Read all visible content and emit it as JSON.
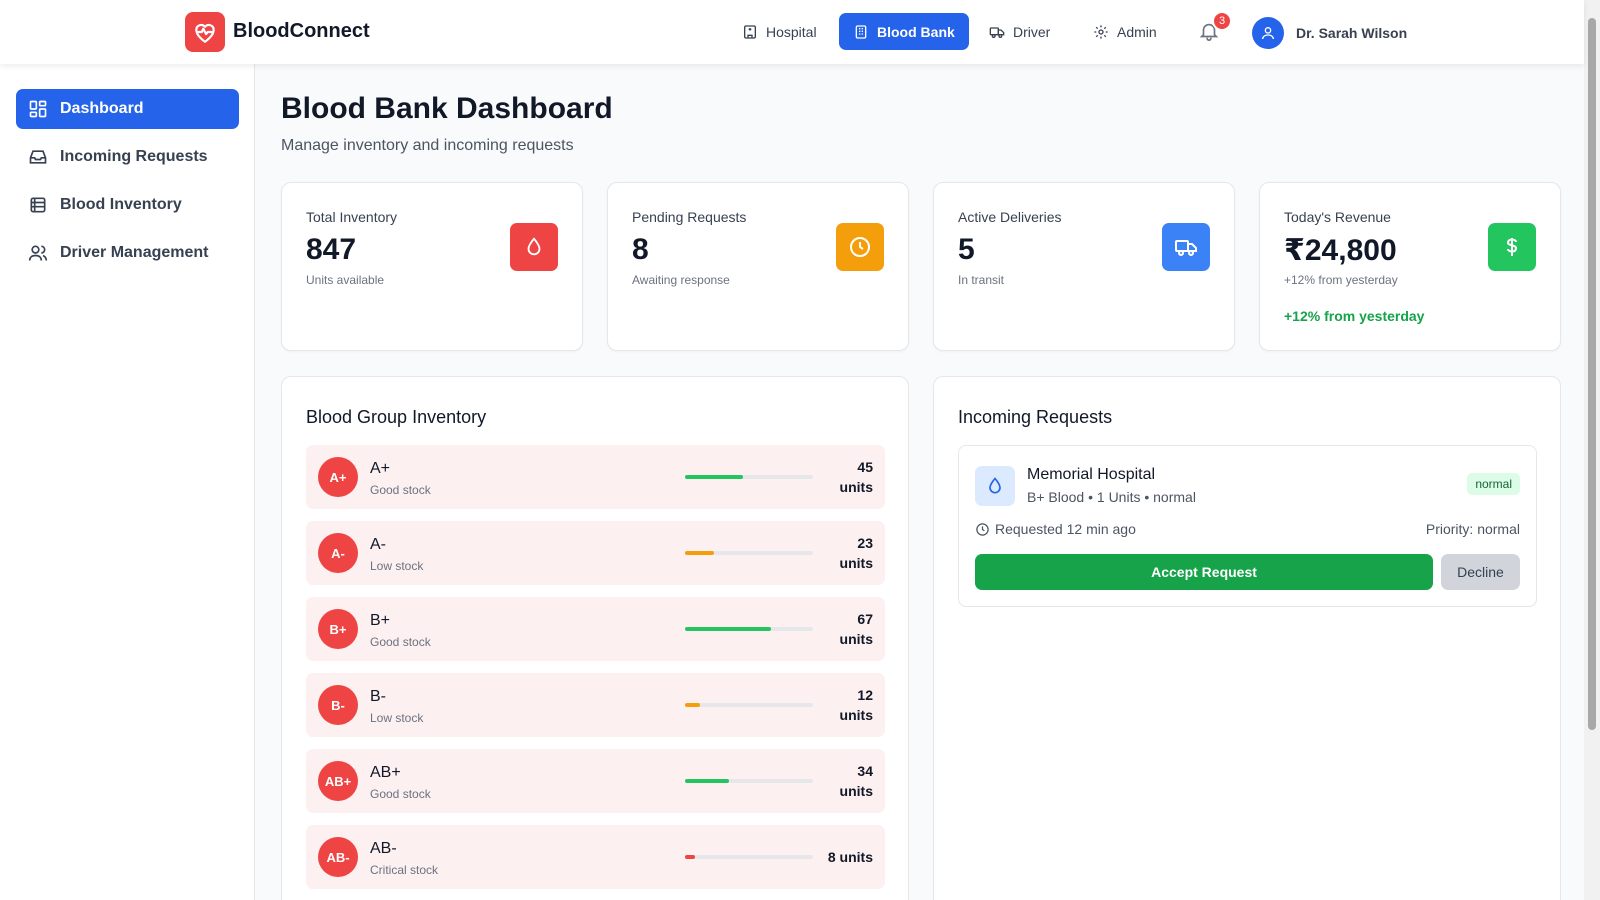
{
  "brand": {
    "name": "BloodConnect",
    "accent": "#ef4444",
    "primary": "#2563eb"
  },
  "nav": [
    {
      "label": "Hospital",
      "icon": "hospital-icon",
      "active": false
    },
    {
      "label": "Blood Bank",
      "icon": "building-icon",
      "active": true
    },
    {
      "label": "Driver",
      "icon": "truck-icon",
      "active": false
    },
    {
      "label": "Admin",
      "icon": "gear-icon",
      "active": false
    }
  ],
  "notifications": {
    "count": "3"
  },
  "user": {
    "name": "Dr. Sarah Wilson"
  },
  "sidebar": {
    "items": [
      {
        "label": "Dashboard",
        "icon": "dashboard-icon",
        "active": true
      },
      {
        "label": "Incoming Requests",
        "icon": "inbox-icon",
        "active": false
      },
      {
        "label": "Blood Inventory",
        "icon": "database-icon",
        "active": false
      },
      {
        "label": "Driver Management",
        "icon": "users-icon",
        "active": false
      }
    ]
  },
  "page": {
    "title": "Blood Bank Dashboard",
    "subtitle": "Manage inventory and incoming requests"
  },
  "stats": [
    {
      "label": "Total Inventory",
      "value": "847",
      "sub": "Units available",
      "trend": "",
      "icon": "droplet-icon",
      "color": "#ef4444"
    },
    {
      "label": "Pending Requests",
      "value": "8",
      "sub": "Awaiting response",
      "trend": "",
      "icon": "clock-icon",
      "color": "#f59e0b"
    },
    {
      "label": "Active Deliveries",
      "value": "5",
      "sub": "In transit",
      "trend": "",
      "icon": "truck-icon",
      "color": "#3b82f6"
    },
    {
      "label": "Today's Revenue",
      "value": "₹24,800",
      "sub": "+12% from yesterday",
      "trend": "+12% from yesterday",
      "icon": "dollar-icon",
      "color": "#22c55e"
    }
  ],
  "inventory": {
    "title": "Blood Group Inventory",
    "groups": [
      {
        "group": "A+",
        "status": "Good stock",
        "count": "45",
        "unit": "units",
        "level": 0.45,
        "color": "#22c55e"
      },
      {
        "group": "A-",
        "status": "Low stock",
        "count": "23",
        "unit": "units",
        "level": 0.23,
        "color": "#f59e0b"
      },
      {
        "group": "B+",
        "status": "Good stock",
        "count": "67",
        "unit": "units",
        "level": 0.67,
        "color": "#22c55e"
      },
      {
        "group": "B-",
        "status": "Low stock",
        "count": "12",
        "unit": "units",
        "level": 0.12,
        "color": "#f59e0b"
      },
      {
        "group": "AB+",
        "status": "Good stock",
        "count": "34",
        "unit": "units",
        "level": 0.34,
        "color": "#22c55e"
      },
      {
        "group": "AB-",
        "status": "Critical stock",
        "count": "8",
        "unit": "units",
        "level": 0.08,
        "color": "#ef4444"
      }
    ]
  },
  "requests": {
    "title": "Incoming Requests",
    "items": [
      {
        "hospital": "Memorial Hospital",
        "details": "B+ Blood • 1 Units • normal",
        "badge": "normal",
        "time": "Requested 12 min ago",
        "priority": "Priority: normal",
        "accept_label": "Accept Request",
        "decline_label": "Decline"
      }
    ]
  }
}
